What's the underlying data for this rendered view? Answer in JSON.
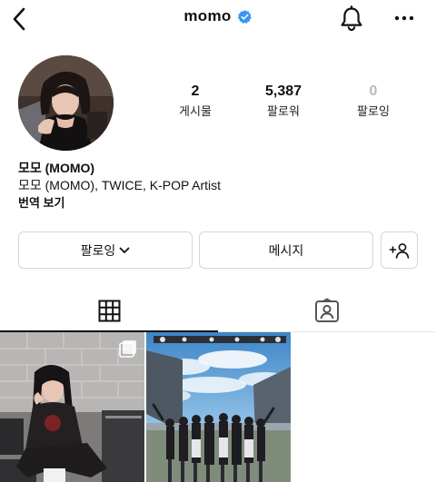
{
  "header": {
    "username": "momo",
    "verified": true,
    "icons": [
      "back-arrow-icon",
      "verified-badge-icon",
      "bell-icon",
      "more-icon"
    ]
  },
  "profile": {
    "stats": [
      {
        "value": "2",
        "label": "게시물"
      },
      {
        "value": "5,387",
        "label": "팔로워"
      },
      {
        "value": "0",
        "label": "팔로잉"
      }
    ],
    "display_name": "모모 (MOMO)",
    "bio": "모모 (MOMO), TWICE, K-POP Artist",
    "translate_label": "번역 보기"
  },
  "actions": {
    "following_label": "팔로잉",
    "message_label": "메시지"
  },
  "tabs": [
    "grid-icon",
    "tagged-icon"
  ],
  "posts": [
    {
      "type": "multi-photo"
    },
    {
      "type": "photo"
    }
  ],
  "colors": {
    "verified": "#3897f0",
    "border": "#d6d6d6",
    "muted_count": "#b9b9b9"
  }
}
